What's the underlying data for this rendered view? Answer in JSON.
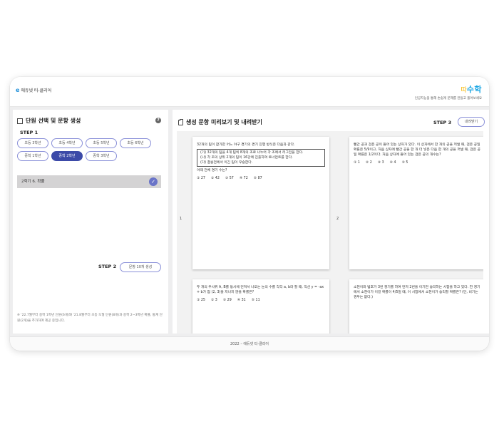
{
  "header": {
    "logo_mark": "e",
    "logo_text": "에듀넷 티-클리어",
    "brand_name": "수학",
    "brand_prefix": "따",
    "brand_tagline": "인공지능을 통해 손쉽게 문제를 만들고 풀어보세요"
  },
  "left": {
    "title": "단원 선택 및 문항 생성",
    "help": "?",
    "step1": "STEP 1",
    "grades": [
      "초등 3학년",
      "초등 4학년",
      "초등 5학년",
      "초등 6학년",
      "중학 1학년",
      "중학 2학년",
      "중학 3학년"
    ],
    "active_grade": "중학 2학년",
    "unit": "2학기 6. 확률",
    "step2": "STEP 2",
    "generate_label": "문항 10개 생성",
    "note": "※ '22.7월부터 중학 1학년 단원(6개)와 '21.8월부터 초등 도형 단원(8개)과 중학 2~3학년 확률, 통계 단원(2개)을 추가하여 제공 중입니다."
  },
  "right": {
    "title": "생성 문항 미리보기 및 내려받기",
    "step3": "STEP 3",
    "download_label": "내려받기",
    "pages": [
      {
        "num": "1",
        "text": "32개의 팀이 참가한 어느 야구 경기의 경기 진행 방식은 다음과 같다.",
        "box": [
          "(가) 32개의 팀을 4개 팀씩 8개의 조로 나누어 각 조에서 리그전을 한다.",
          "(나) 각 조의 상위 2개의 팀이 16강에 진출하여 토너먼트를 한다.",
          "(다) 결승전에서 이긴 팀이 우승한다."
        ],
        "question": "이때 전체 경기 수는?",
        "choices": [
          "① 27",
          "② 42",
          "③ 57",
          "④ 72",
          "⑤ 87"
        ]
      },
      {
        "num": "2",
        "text": "빨간 공과 검은 공이 들어 있는 상자가 있다. 이 상자에서 한 개의 공을 꺼낼 때, 검은 공일 확률은 5/9이고, 처음 상자에 빨간 공을 한 개 더 넣은 다음 한 개의 공을 꺼낼 때, 검은 공일 확률은 1/2이다. 처음 상자에 들어 있는 검은 공의 개수는?",
        "choices": [
          "① 1",
          "② 2",
          "③ 3",
          "④ 4",
          "⑤ 5"
        ]
      },
      {
        "text": "두 개의 주사위 A, B를 동시에 던져서 나오는 눈의 수를 각각 a, b라 할 때, 직선 y = -ax + b가 점 (2, 3)을 지나지 않을 확률은?",
        "choices": [
          "① 25",
          "② 3",
          "③ 29",
          "④ 31",
          "⑤ 11"
        ]
      },
      {
        "text": "소현이와 범호가 3번 경기를 하여 먼저 2번을 이기면 승리하는 시합을 하고 있다. 한 경기에서 소현이가 이길 확률이 4/5일 때, 이 시합에서 소현이가 승리할 확률은? (단, 비기는 경우는 없다.)"
      }
    ]
  },
  "footer": "2022 – 에듀넷 티-클리어"
}
